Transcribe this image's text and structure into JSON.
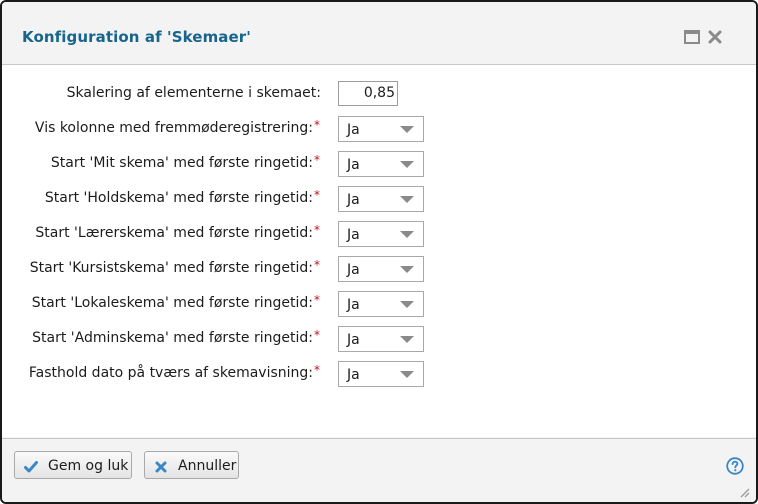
{
  "dialog": {
    "title": "Konfiguration af 'Skemaer'",
    "maximize_icon": "maximize-icon",
    "close_icon": "close-icon"
  },
  "form": {
    "scale": {
      "label": "Skalering af elementerne i skemaet:",
      "value": "0,85"
    },
    "fields": [
      {
        "label": "Vis kolonne med fremmøderegistrering:",
        "required_mark": "*",
        "value": "Ja"
      },
      {
        "label": "Start 'Mit skema' med første ringetid:",
        "required_mark": "*",
        "value": "Ja"
      },
      {
        "label": "Start 'Holdskema' med første ringetid:",
        "required_mark": "*",
        "value": "Ja"
      },
      {
        "label": "Start 'Lærerskema' med første ringetid:",
        "required_mark": "*",
        "value": "Ja"
      },
      {
        "label": "Start 'Kursistskema' med første ringetid:",
        "required_mark": "*",
        "value": "Ja"
      },
      {
        "label": "Start 'Lokaleskema' med første ringetid:",
        "required_mark": "*",
        "value": "Ja"
      },
      {
        "label": "Start 'Adminskema' med første ringetid:",
        "required_mark": "*",
        "value": "Ja"
      },
      {
        "label": "Fasthold dato på tværs af skemavisning:",
        "required_mark": "*",
        "value": "Ja"
      }
    ]
  },
  "footer": {
    "save_label": "Gem og luk",
    "cancel_label": "Annuller",
    "help_icon": "help-icon"
  },
  "colors": {
    "title": "#17658c",
    "required": "#c0141e",
    "check": "#3a87c8",
    "cancel_x": "#3a87c8"
  }
}
